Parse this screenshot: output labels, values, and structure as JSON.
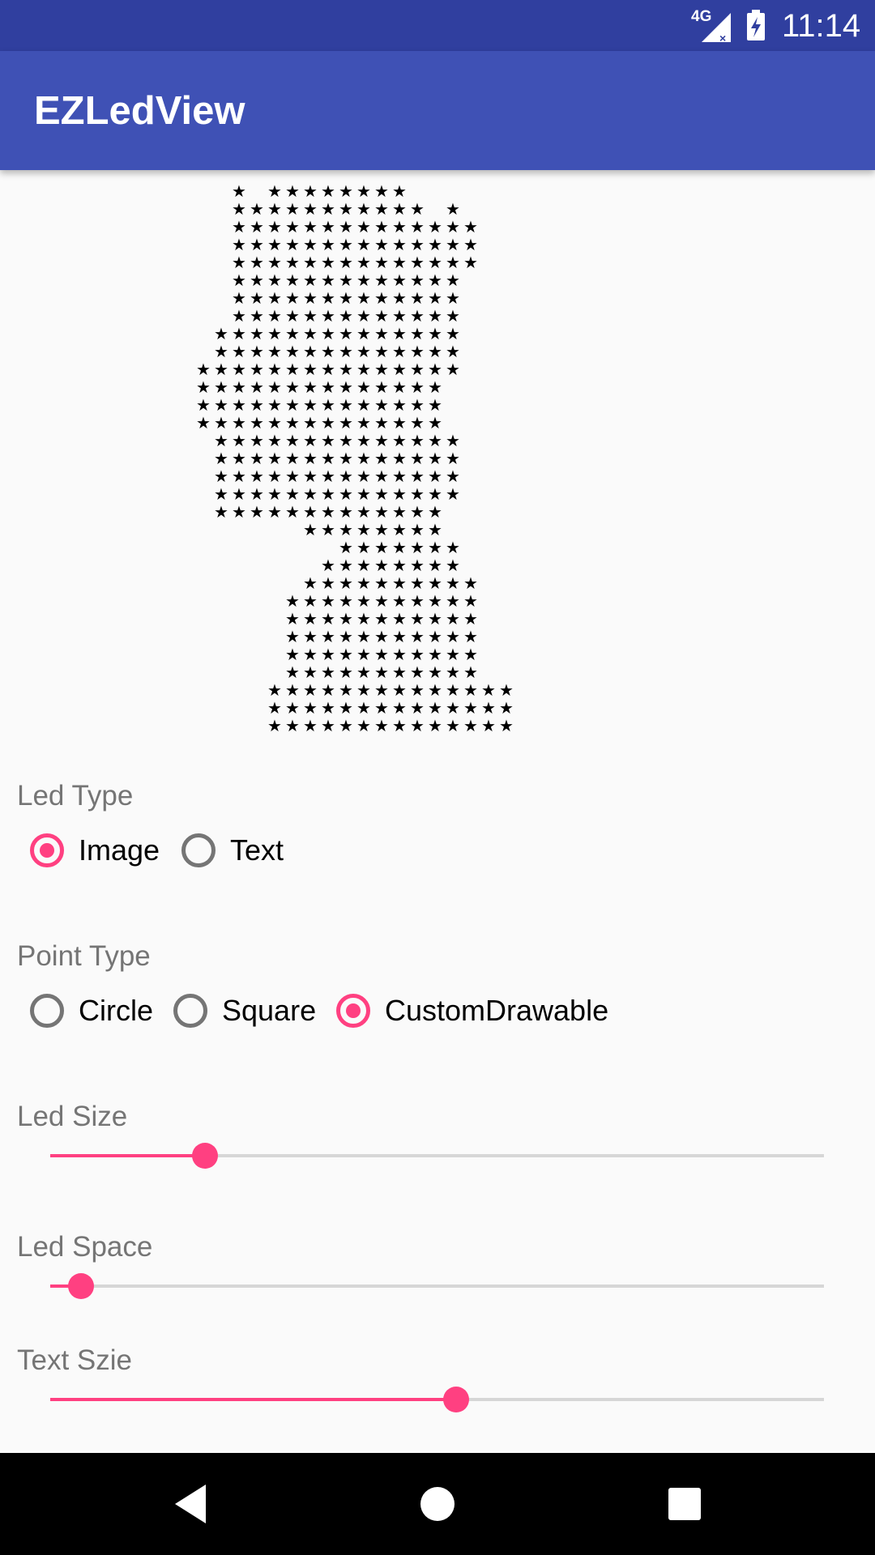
{
  "status_bar": {
    "network": "4G",
    "time": "11:14"
  },
  "app_bar": {
    "title": "EZLedView"
  },
  "led_view": {
    "glyph": "★",
    "rows": [
      "X.XXXXXXXX...........",
      "XXXXXXXXXXX.X........",
      "XXXXXXXXXXXXXX.......",
      "XXXXXXXXXXXXXX.......",
      "XXXXXXXXXXXXXX.......",
      "XXXXXXXXXXXXX........",
      "XXXXXXXXXXXXX........",
      "XXXXXXXXXXXXX........",
      "XXXXXXXXXXXXXX.......",
      "XXXXXXXXXXXXXX.......",
      "XXXXXXXXXXXXXXX......",
      "XXXXXXXXXXXXXX.......",
      "XXXXXXXXXXXXXX.......",
      "XXXXXXXXXXXXXX.......",
      "XXXXXXXXXXXXXX.......",
      "XXXXXXXXXXXXXX.......",
      "XXXXXXXXXXXXXX.......",
      "XXXXXXXXXXXXXX.......",
      "XXXXXXXXXXXXX........",
      "XXXXXXXX.............",
      "XXXXXXX..............",
      "XXXXXXXX.............",
      "XXXXXXXXXX...........",
      "XXXXXXXXXXX..........",
      "XXXXXXXXXXX..........",
      "XXXXXXXXXXX..........",
      "XXXXXXXXXXX..........",
      "XXXXXXXXXXX..........",
      "XXXXXXXXXXXXXX.......",
      "XXXXXXXXXXXXXX.......",
      "XXXXXXXXXXXXXX......."
    ],
    "row_offsets": [
      12,
      12,
      12,
      12,
      12,
      12,
      12,
      12,
      11,
      11,
      10,
      10,
      10,
      10,
      11,
      11,
      11,
      11,
      11,
      16,
      18,
      17,
      16,
      15,
      15,
      15,
      15,
      15,
      14,
      14,
      14
    ]
  },
  "led_type": {
    "label": "Led Type",
    "options": [
      {
        "label": "Image",
        "checked": true
      },
      {
        "label": "Text",
        "checked": false
      }
    ]
  },
  "point_type": {
    "label": "Point Type",
    "options": [
      {
        "label": "Circle",
        "checked": false
      },
      {
        "label": "Square",
        "checked": false
      },
      {
        "label": "CustomDrawable",
        "checked": true
      }
    ]
  },
  "led_size": {
    "label": "Led Size",
    "progress": 0.2
  },
  "led_space": {
    "label": "Led Space",
    "progress": 0.04
  },
  "text_size": {
    "label": "Text Szie",
    "progress": 0.525
  },
  "colors": {
    "primary": "#3f51b5",
    "primary_dark": "#303f9f",
    "accent": "#ff4081",
    "label_gray": "#757575"
  }
}
